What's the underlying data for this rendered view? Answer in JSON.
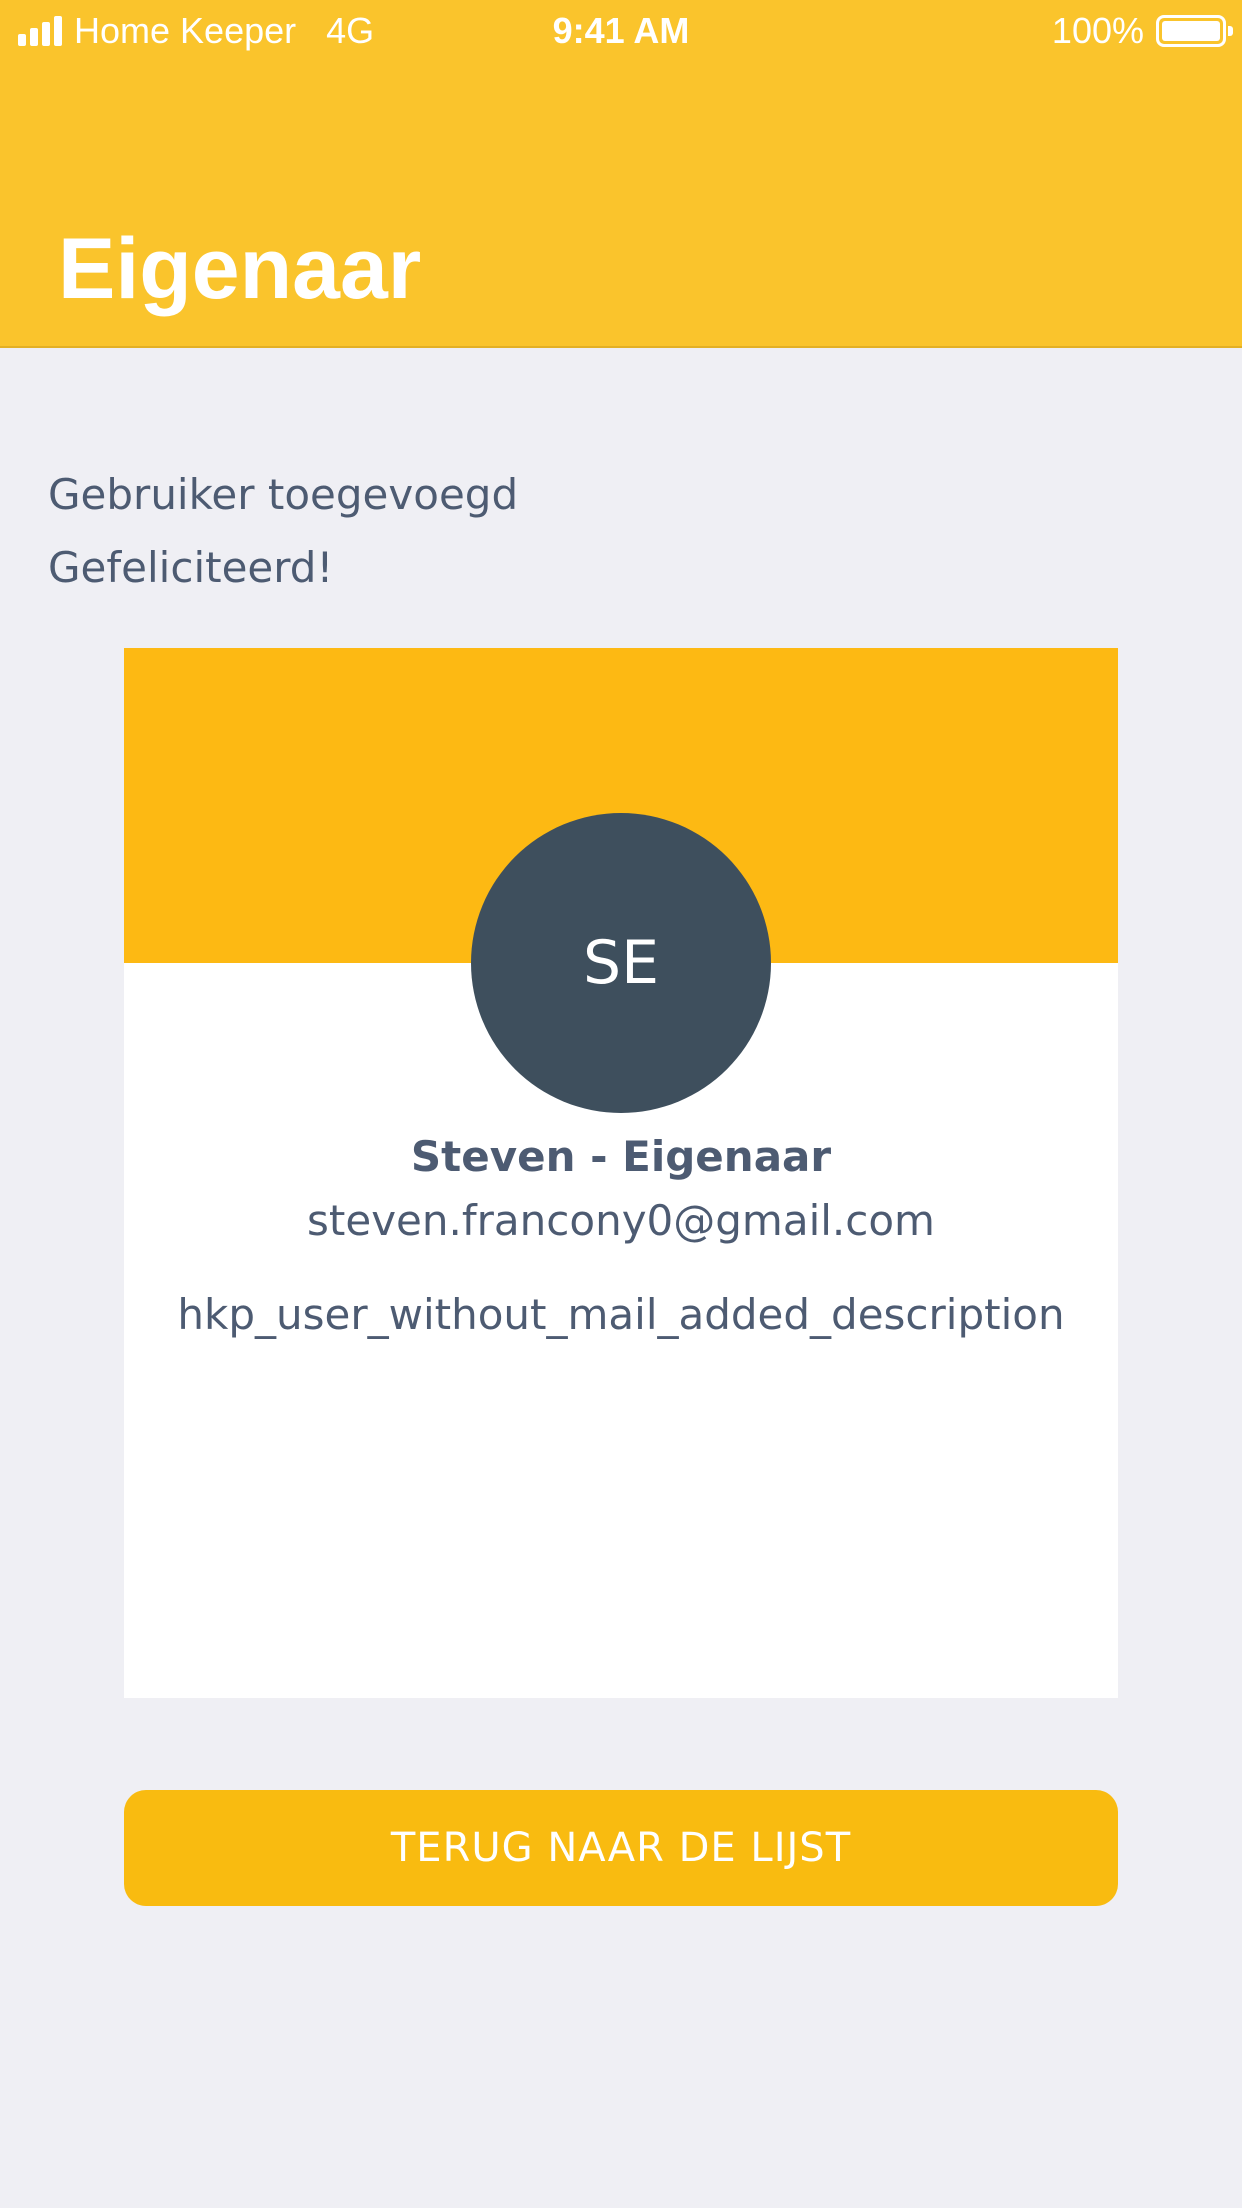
{
  "status_bar": {
    "carrier": "Home Keeper",
    "network": "4G",
    "time": "9:41 AM",
    "battery": "100%",
    "signal_icon": "signal-bars-icon",
    "battery_icon": "battery-icon"
  },
  "header": {
    "title": "Eigenaar",
    "background": "#fac42c"
  },
  "message": {
    "line1": "Gebruiker toegevoegd",
    "line2": "Gefeliciteerd!"
  },
  "user_card": {
    "banner_color": "#fdb913",
    "initials": "SE",
    "avatar_color": "#3e4f5d",
    "name": "Steven - Eigenaar",
    "email": "steven.francony0@gmail.com",
    "description": "hkp_user_without_mail_added_description"
  },
  "actions": {
    "back_label": "TERUG NAAR DE LIJST",
    "accent": "#f9bb10"
  }
}
